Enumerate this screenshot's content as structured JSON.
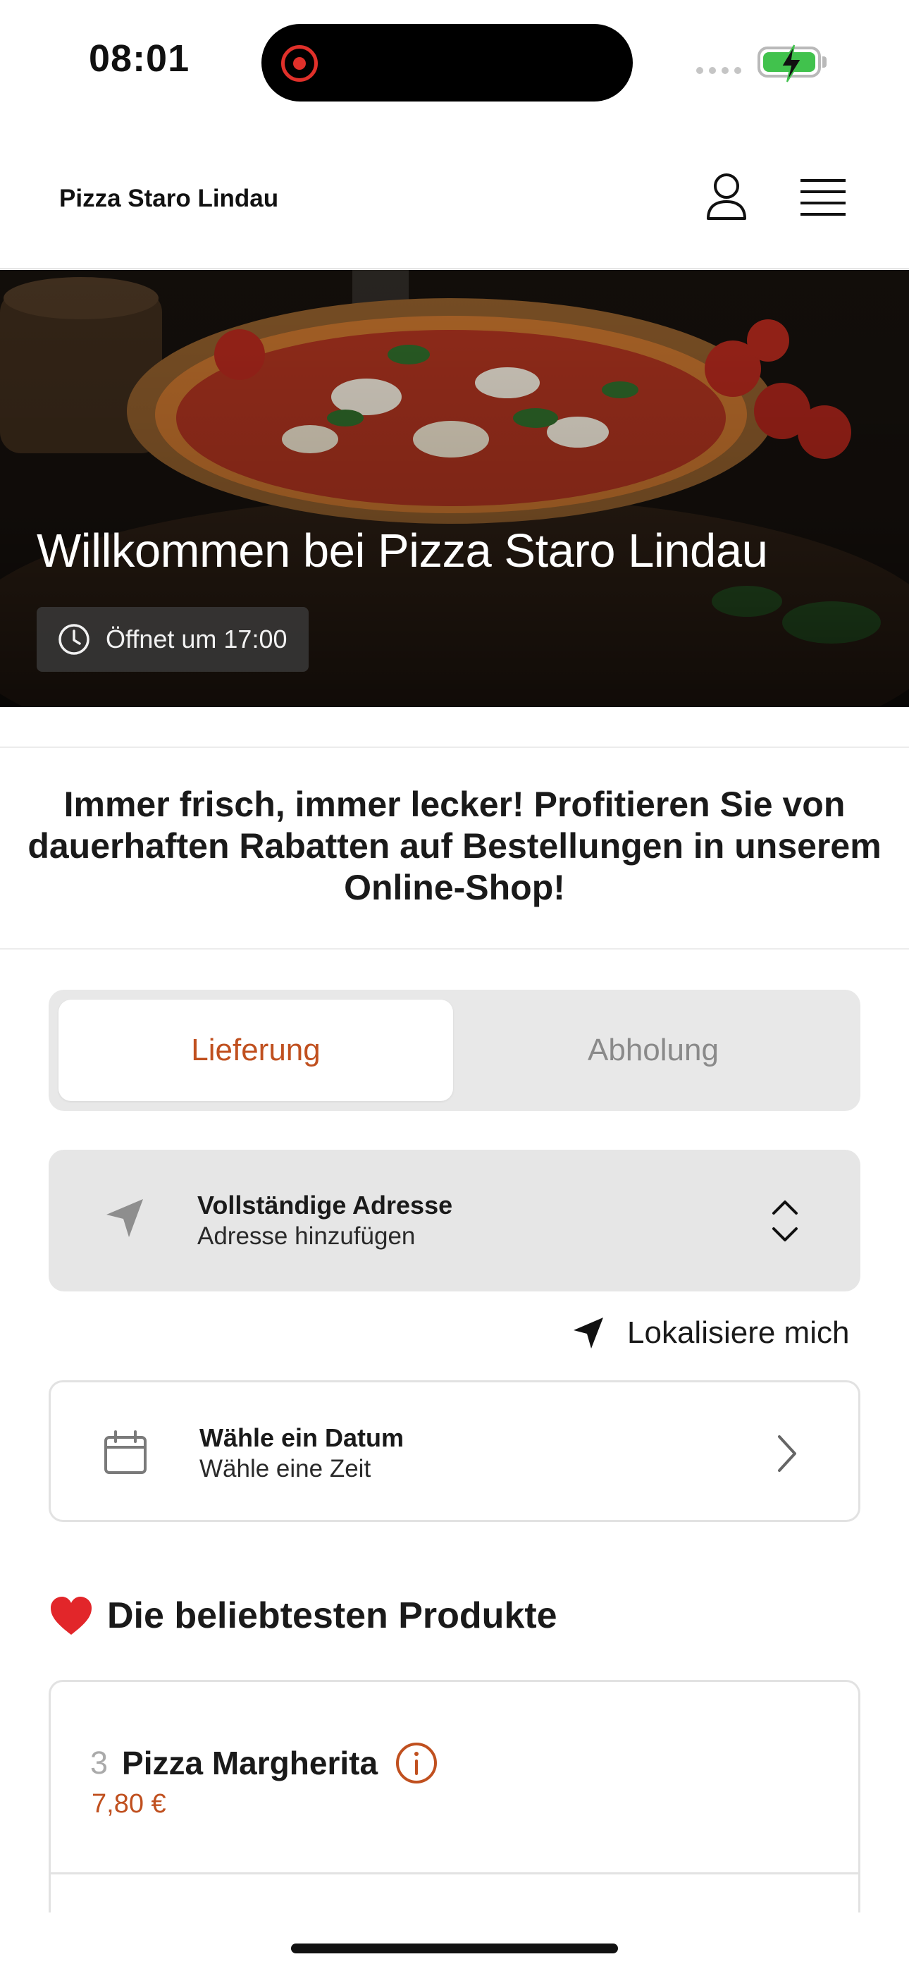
{
  "status_bar": {
    "time": "08:01"
  },
  "header": {
    "brand": "Pizza Staro Lindau"
  },
  "hero": {
    "title": "Willkommen bei Pizza Staro Lindau",
    "hours": "Öffnet um 17:00"
  },
  "promo": {
    "text": "Immer frisch, immer lecker! Profitieren Sie von dauerhaften Rabatten auf Bestellungen in unserem Online-Shop!"
  },
  "order_mode": {
    "delivery_label": "Lieferung",
    "pickup_label": "Abholung",
    "selected": "Lieferung"
  },
  "address": {
    "title": "Vollständige Adresse",
    "subtitle": "Adresse hinzufügen"
  },
  "locate": {
    "label": "Lokalisiere mich"
  },
  "schedule": {
    "title": "Wähle ein Datum",
    "subtitle": "Wähle eine Zeit"
  },
  "popular": {
    "heading": "Die beliebtesten Produkte",
    "products": [
      {
        "rank": "3",
        "name": "Pizza Margherita",
        "price": "7,80 €"
      }
    ]
  },
  "colors": {
    "accent": "#c0501f",
    "card_gray": "#e6e6e6",
    "battery_green": "#41c24d",
    "recording_red": "#e0302a"
  },
  "icons": [
    "record-icon",
    "battery-icon",
    "user-icon",
    "hamburger-menu-icon",
    "clock-icon",
    "navigation-arrow-icon",
    "chevron-up-down-icon",
    "calendar-icon",
    "chevron-right-icon",
    "heart-icon",
    "info-icon"
  ]
}
